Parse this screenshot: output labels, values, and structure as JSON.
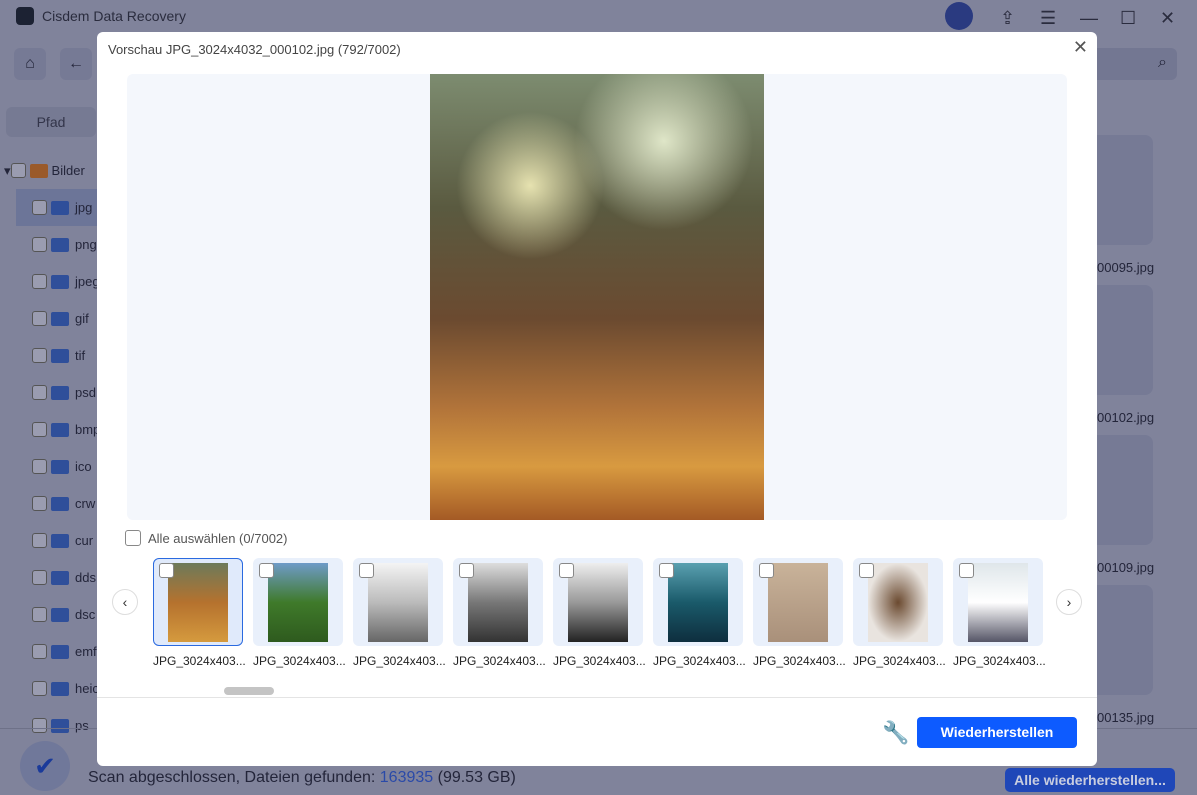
{
  "app": {
    "title": "Cisdem Data Recovery",
    "tab_path": "Pfad",
    "tree_root": "Bilder",
    "tree_items": [
      "jpg",
      "png",
      "jpeg",
      "gif",
      "tif",
      "psd",
      "bmp",
      "ico",
      "crw",
      "cur",
      "dds",
      "dsc",
      "emf",
      "heic",
      "ps"
    ],
    "right_files": [
      "00095.jpg",
      "00102.jpg",
      "00109.jpg",
      "00135.jpg"
    ],
    "status_prefix": "Scan abgeschlossen, Dateien gefunden: ",
    "status_count": "163935",
    "status_size": "(99.53 GB)",
    "recover_all": "Alle wiederherstellen..."
  },
  "modal": {
    "title": "Vorschau JPG_3024x4032_000102.jpg (792/7002)",
    "select_all": "Alle auswählen (0/7002)",
    "restore": "Wiederherstellen",
    "thumbnails": [
      {
        "label": "JPG_3024x403...",
        "subject": "autumn-leaves",
        "selected": true
      },
      {
        "label": "JPG_3024x403...",
        "subject": "grass"
      },
      {
        "label": "JPG_3024x403...",
        "subject": "bridge-arch"
      },
      {
        "label": "JPG_3024x403...",
        "subject": "mountain-lake"
      },
      {
        "label": "JPG_3024x403...",
        "subject": "eiffel-tower"
      },
      {
        "label": "JPG_3024x403...",
        "subject": "kayak"
      },
      {
        "label": "JPG_3024x403...",
        "subject": "sand-footprints"
      },
      {
        "label": "JPG_3024x403...",
        "subject": "coffee-beans"
      },
      {
        "label": "JPG_3024x403...",
        "subject": "snowy-mountain"
      }
    ]
  },
  "colors": {
    "accent": "#0d5bff"
  }
}
